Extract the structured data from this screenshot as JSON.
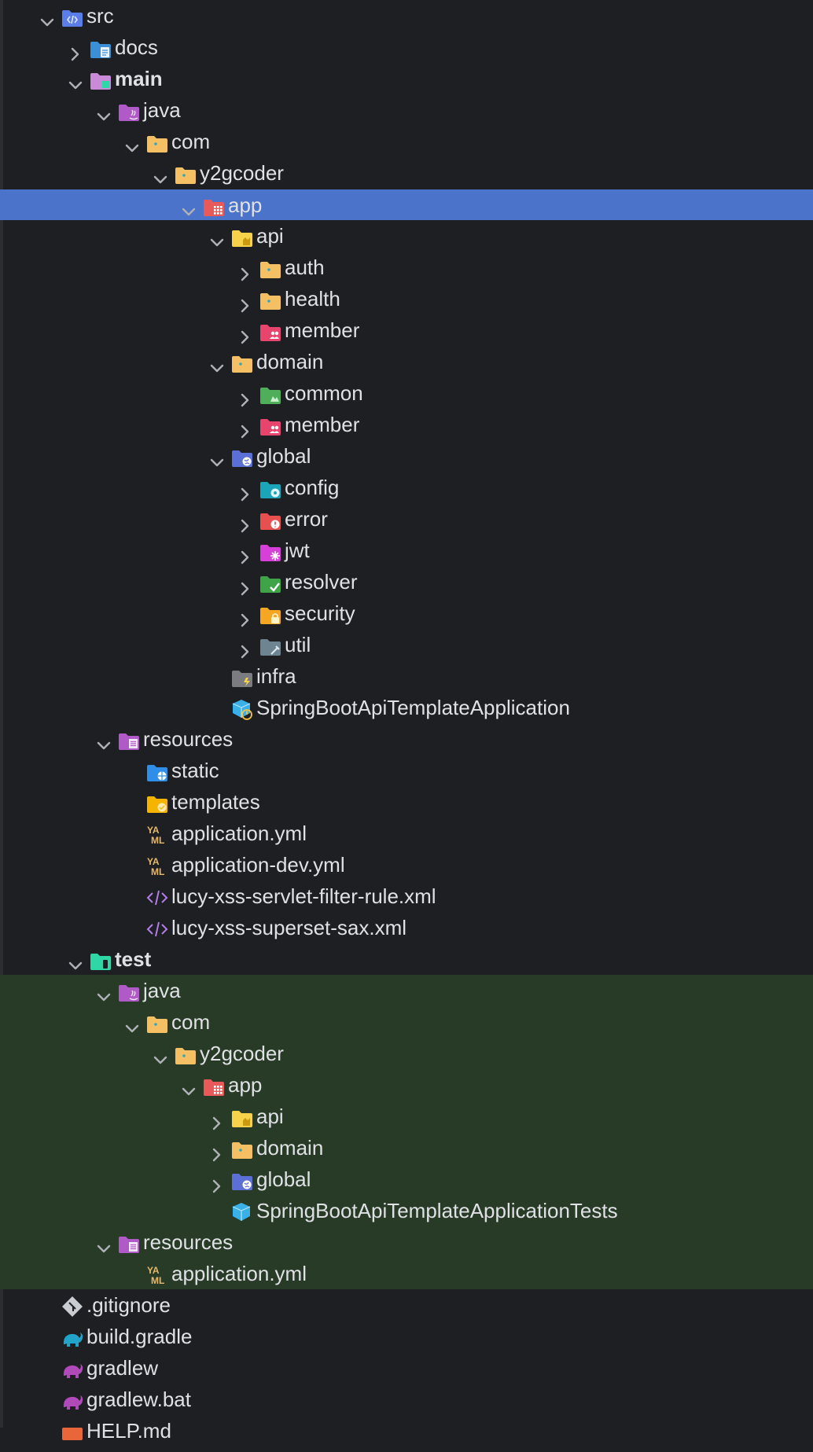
{
  "tree": [
    {
      "label": "src",
      "depth": 0,
      "expand": "open",
      "icon": "source-folder-icon",
      "color": "#5b7de8"
    },
    {
      "label": "docs",
      "depth": 1,
      "expand": "closed",
      "icon": "docs-folder-icon",
      "color": "#3a8fd6"
    },
    {
      "label": "main",
      "depth": 1,
      "expand": "open",
      "icon": "main-folder-icon",
      "color": "#c98ad8",
      "bold": true
    },
    {
      "label": "java",
      "depth": 2,
      "expand": "open",
      "icon": "java-folder-icon",
      "color": "#b05ac8"
    },
    {
      "label": "com",
      "depth": 3,
      "expand": "open",
      "icon": "package-folder-icon",
      "color": "#f5c064"
    },
    {
      "label": "y2gcoder",
      "depth": 4,
      "expand": "open",
      "icon": "package-folder-icon",
      "color": "#f5c064"
    },
    {
      "label": "app",
      "depth": 5,
      "expand": "open",
      "icon": "app-folder-icon",
      "color": "#e85a5a",
      "selected": true
    },
    {
      "label": "api",
      "depth": 6,
      "expand": "open",
      "icon": "api-folder-icon",
      "color": "#f5d24a"
    },
    {
      "label": "auth",
      "depth": 7,
      "expand": "closed",
      "icon": "package-folder-icon",
      "color": "#f5c064"
    },
    {
      "label": "health",
      "depth": 7,
      "expand": "closed",
      "icon": "package-folder-icon",
      "color": "#f5c064"
    },
    {
      "label": "member",
      "depth": 7,
      "expand": "closed",
      "icon": "member-folder-icon",
      "color": "#e8456e"
    },
    {
      "label": "domain",
      "depth": 6,
      "expand": "open",
      "icon": "package-folder-icon",
      "color": "#f5c064"
    },
    {
      "label": "common",
      "depth": 7,
      "expand": "closed",
      "icon": "common-folder-icon",
      "color": "#4fae5a"
    },
    {
      "label": "member",
      "depth": 7,
      "expand": "closed",
      "icon": "member-folder-icon",
      "color": "#e8456e"
    },
    {
      "label": "global",
      "depth": 6,
      "expand": "open",
      "icon": "global-folder-icon",
      "color": "#5b6fd6"
    },
    {
      "label": "config",
      "depth": 7,
      "expand": "closed",
      "icon": "config-folder-icon",
      "color": "#1aa5b8"
    },
    {
      "label": "error",
      "depth": 7,
      "expand": "closed",
      "icon": "error-folder-icon",
      "color": "#e85050"
    },
    {
      "label": "jwt",
      "depth": 7,
      "expand": "closed",
      "icon": "jwt-folder-icon",
      "color": "#d640d8"
    },
    {
      "label": "resolver",
      "depth": 7,
      "expand": "closed",
      "icon": "resolver-folder-icon",
      "color": "#3fa448"
    },
    {
      "label": "security",
      "depth": 7,
      "expand": "closed",
      "icon": "security-folder-icon",
      "color": "#f5a623"
    },
    {
      "label": "util",
      "depth": 7,
      "expand": "closed",
      "icon": "util-folder-icon",
      "color": "#6e8490"
    },
    {
      "label": "infra",
      "depth": 6,
      "expand": "none",
      "icon": "infra-folder-icon",
      "color": "#7a7c80"
    },
    {
      "label": "SpringBootApiTemplateApplication",
      "depth": 6,
      "expand": "none",
      "icon": "spring-app-class-icon",
      "color": "#3ab0e8"
    },
    {
      "label": "resources",
      "depth": 2,
      "expand": "open",
      "icon": "resources-folder-icon",
      "color": "#b05ac8"
    },
    {
      "label": "static",
      "depth": 3,
      "expand": "none",
      "icon": "static-folder-icon",
      "color": "#2f8ee8"
    },
    {
      "label": "templates",
      "depth": 3,
      "expand": "none",
      "icon": "templates-folder-icon",
      "color": "#f5b400"
    },
    {
      "label": "application.yml",
      "depth": 3,
      "expand": "none",
      "icon": "yaml-file-icon",
      "color": "#e8b86a"
    },
    {
      "label": "application-dev.yml",
      "depth": 3,
      "expand": "none",
      "icon": "yaml-file-icon",
      "color": "#e8b86a"
    },
    {
      "label": "lucy-xss-servlet-filter-rule.xml",
      "depth": 3,
      "expand": "none",
      "icon": "xml-file-icon",
      "color": "#b07ee8"
    },
    {
      "label": "lucy-xss-superset-sax.xml",
      "depth": 3,
      "expand": "none",
      "icon": "xml-file-icon",
      "color": "#b07ee8"
    },
    {
      "label": "test",
      "depth": 1,
      "expand": "open",
      "icon": "test-folder-icon",
      "color": "#2fd6a6",
      "bold": true
    },
    {
      "label": "java",
      "depth": 2,
      "expand": "open",
      "icon": "java-folder-icon",
      "color": "#b05ac8",
      "test": true
    },
    {
      "label": "com",
      "depth": 3,
      "expand": "open",
      "icon": "package-folder-icon",
      "color": "#f5c064",
      "test": true
    },
    {
      "label": "y2gcoder",
      "depth": 4,
      "expand": "open",
      "icon": "package-folder-icon",
      "color": "#f5c064",
      "test": true
    },
    {
      "label": "app",
      "depth": 5,
      "expand": "open",
      "icon": "app-folder-icon",
      "color": "#e85a5a",
      "test": true
    },
    {
      "label": "api",
      "depth": 6,
      "expand": "closed",
      "icon": "api-folder-icon",
      "color": "#f5d24a",
      "test": true
    },
    {
      "label": "domain",
      "depth": 6,
      "expand": "closed",
      "icon": "package-folder-icon",
      "color": "#f5c064",
      "test": true
    },
    {
      "label": "global",
      "depth": 6,
      "expand": "closed",
      "icon": "global-folder-icon",
      "color": "#5b6fd6",
      "test": true
    },
    {
      "label": "SpringBootApiTemplateApplicationTests",
      "depth": 6,
      "expand": "none",
      "icon": "spring-test-class-icon",
      "color": "#3ab0e8",
      "test": true
    },
    {
      "label": "resources",
      "depth": 2,
      "expand": "open",
      "icon": "resources-folder-icon",
      "color": "#b05ac8",
      "test": true
    },
    {
      "label": "application.yml",
      "depth": 3,
      "expand": "none",
      "icon": "yaml-file-icon",
      "color": "#e8b86a",
      "test": true
    },
    {
      "label": ".gitignore",
      "depth": 0,
      "expand": "none",
      "icon": "git-file-icon",
      "color": "#c9ccd1"
    },
    {
      "label": "build.gradle",
      "depth": 0,
      "expand": "none",
      "icon": "gradle-file-icon",
      "color": "#22a3c9"
    },
    {
      "label": "gradlew",
      "depth": 0,
      "expand": "none",
      "icon": "gradle-file-icon",
      "color": "#b04ab8"
    },
    {
      "label": "gradlew.bat",
      "depth": 0,
      "expand": "none",
      "icon": "gradle-file-icon",
      "color": "#b04ab8"
    },
    {
      "label": "HELP.md",
      "depth": 0,
      "expand": "none",
      "icon": "markdown-file-icon",
      "color": "#e8663a"
    }
  ]
}
